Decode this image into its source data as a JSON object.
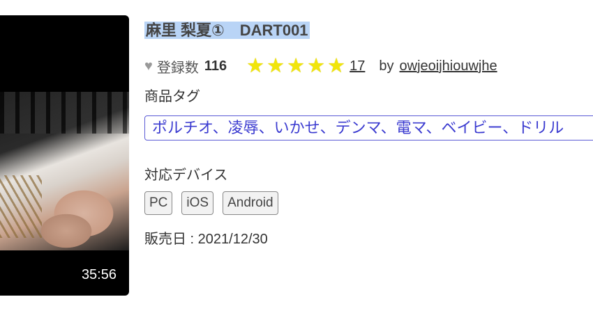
{
  "video": {
    "duration": "35:56"
  },
  "product": {
    "title": "麻里 梨夏①　DART001",
    "favorites_label": "登録数",
    "favorites_count": "116",
    "rating": 5,
    "review_count": "17",
    "by_label": "by",
    "author": "owjeoijhiouwjhe"
  },
  "tags": {
    "heading": "商品タグ",
    "text": "ポルチオ、凌辱、いかせ、デンマ、電マ、ベイビー、ドリル"
  },
  "devices": {
    "heading": "対応デバイス",
    "items": [
      "PC",
      "iOS",
      "Android"
    ]
  },
  "release": {
    "text": "販売日 : 2021/12/30"
  },
  "colors": {
    "star": "#f1e50b",
    "tag_border": "#5b5bd6",
    "tag_text": "#3b3bd0",
    "title_highlight": "#b9d4f6"
  }
}
